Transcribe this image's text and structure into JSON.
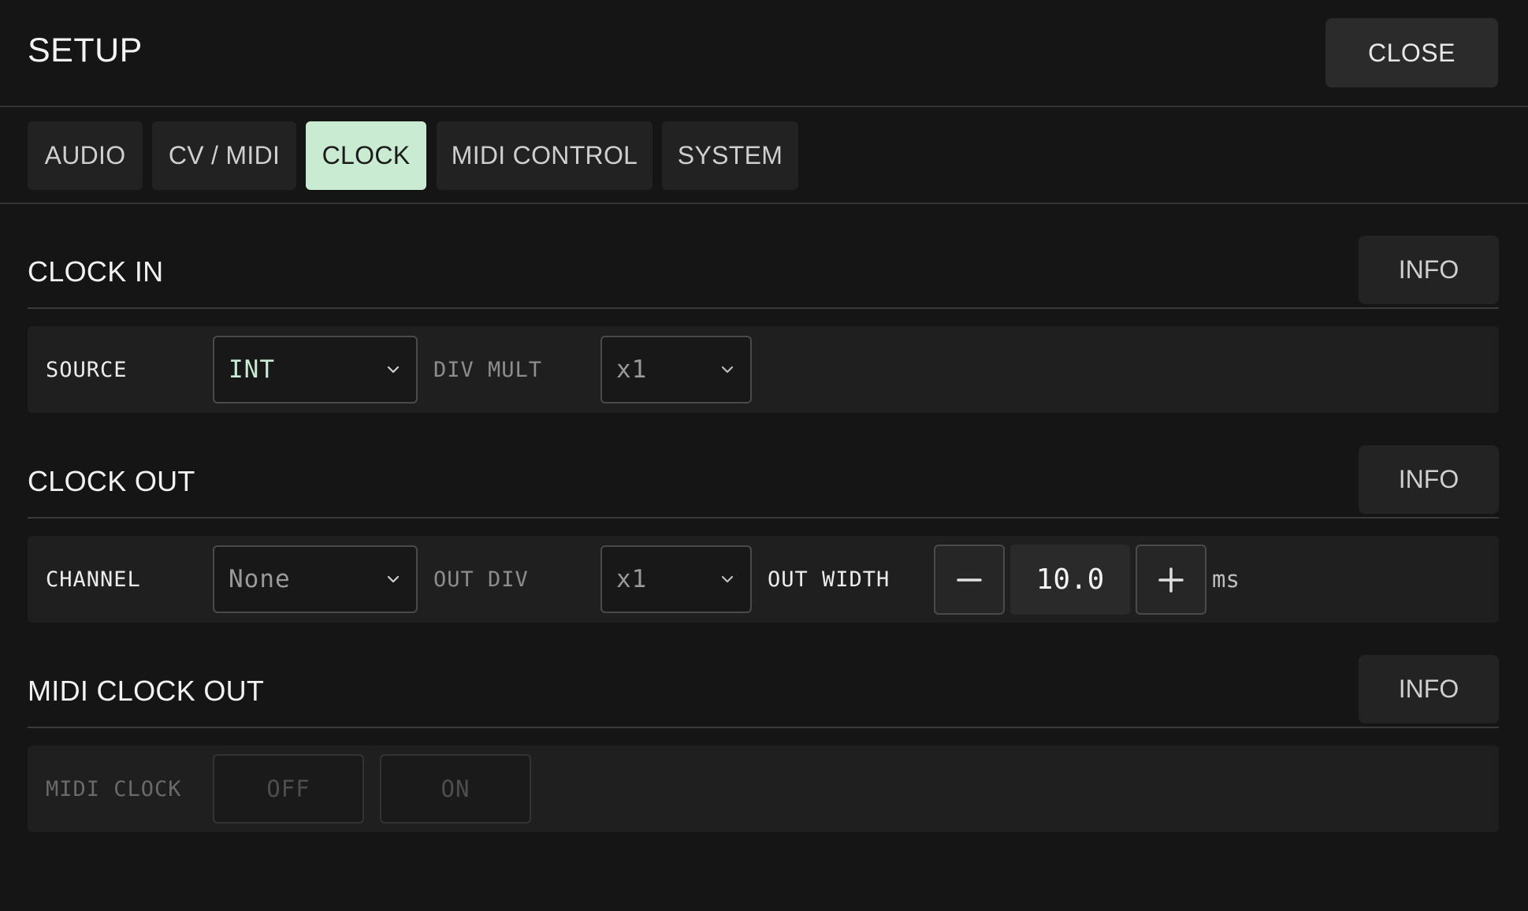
{
  "header": {
    "title": "SETUP",
    "close_label": "CLOSE"
  },
  "tabs": [
    {
      "label": "AUDIO",
      "active": false
    },
    {
      "label": "CV / MIDI",
      "active": false
    },
    {
      "label": "CLOCK",
      "active": true
    },
    {
      "label": "MIDI CONTROL",
      "active": false
    },
    {
      "label": "SYSTEM",
      "active": false
    }
  ],
  "clock_in": {
    "title": "CLOCK IN",
    "info_label": "INFO",
    "source_label": "SOURCE",
    "source_value": "INT",
    "div_mult_label": "DIV MULT",
    "div_mult_value": "x1"
  },
  "clock_out": {
    "title": "CLOCK OUT",
    "info_label": "INFO",
    "channel_label": "CHANNEL",
    "channel_value": "None",
    "out_div_label": "OUT DIV",
    "out_div_value": "x1",
    "out_width_label": "OUT WIDTH",
    "out_width_value": "10.0",
    "out_width_unit": "ms"
  },
  "midi_clock_out": {
    "title": "MIDI CLOCK OUT",
    "info_label": "INFO",
    "midi_clock_label": "MIDI CLOCK",
    "off_label": "OFF",
    "on_label": "ON"
  },
  "colors": {
    "background": "#151515",
    "accent": "#c8ebd1",
    "panel": "#1f1f1f"
  },
  "icons": {
    "select_chevron": "chevron-down-icon",
    "decrement": "minus-icon",
    "increment": "plus-icon"
  }
}
